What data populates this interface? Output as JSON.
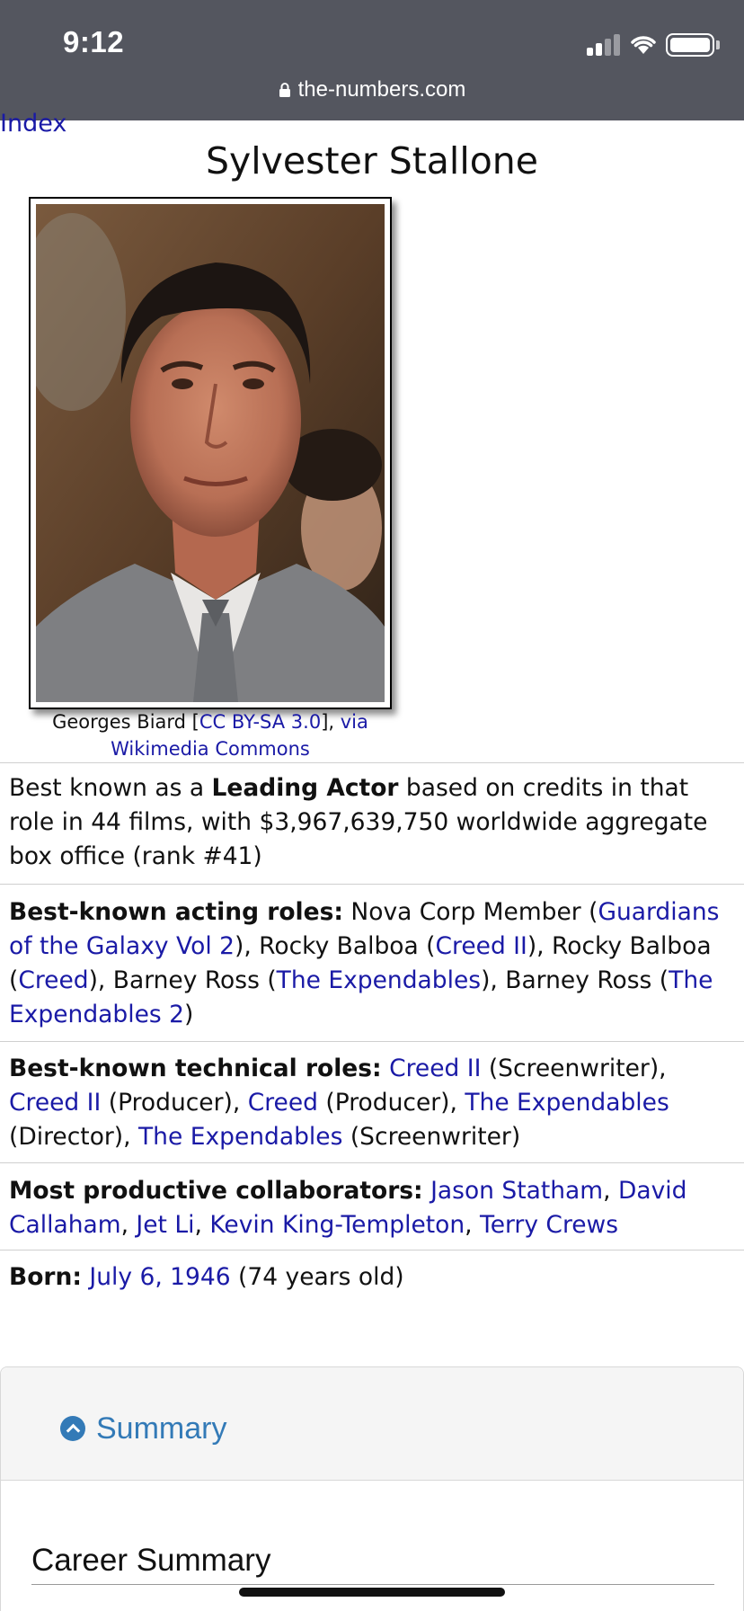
{
  "status_bar": {
    "time": "9:12",
    "url": "the-numbers.com",
    "icons": [
      "signal-icon",
      "wifi-icon",
      "battery-icon",
      "lock-icon"
    ]
  },
  "nav": {
    "index_link": "Index"
  },
  "title": "Sylvester Stallone",
  "photo": {
    "caption_author": "Georges Biard [",
    "caption_license": "CC BY-SA 3.0",
    "caption_mid": "], ",
    "caption_via": "via Wikimedia Commons"
  },
  "best_known": {
    "pre": "Best known as a ",
    "role": "Leading Actor",
    "post": " based on credits in that role in 44 films, with $3,967,639,750 worldwide aggregate box office (rank #41)"
  },
  "acting_roles": {
    "label": "Best-known acting roles:",
    "items": [
      {
        "character": "Nova Corp Member",
        "film": "Guardians of the Galaxy Vol 2"
      },
      {
        "character": "Rocky Balboa",
        "film": "Creed II"
      },
      {
        "character": "Rocky Balboa",
        "film": "Creed"
      },
      {
        "character": "Barney Ross",
        "film": "The Expendables"
      },
      {
        "character": "Barney Ross",
        "film": "The Expendables 2"
      }
    ]
  },
  "technical_roles": {
    "label": "Best-known technical roles:",
    "items": [
      {
        "film": "Creed II",
        "role": "Screenwriter"
      },
      {
        "film": "Creed II",
        "role": "Producer"
      },
      {
        "film": "Creed",
        "role": "Producer"
      },
      {
        "film": "The Expendables",
        "role": "Director"
      },
      {
        "film": "The Expendables",
        "role": "Screenwriter"
      }
    ]
  },
  "collaborators": {
    "label": "Most productive collaborators:",
    "names": [
      "Jason Statham",
      "David Callaham",
      "Jet Li",
      "Kevin King-Templeton",
      "Terry Crews"
    ]
  },
  "born": {
    "label": "Born:",
    "date": "July 6, 1946",
    "age": "(74 years old)"
  },
  "summary": {
    "toggle_label": "Summary",
    "section_title": "Career Summary"
  },
  "colors": {
    "status_bar": "#54565f",
    "link": "#1a1aa6",
    "summary_accent": "#337ab7"
  }
}
